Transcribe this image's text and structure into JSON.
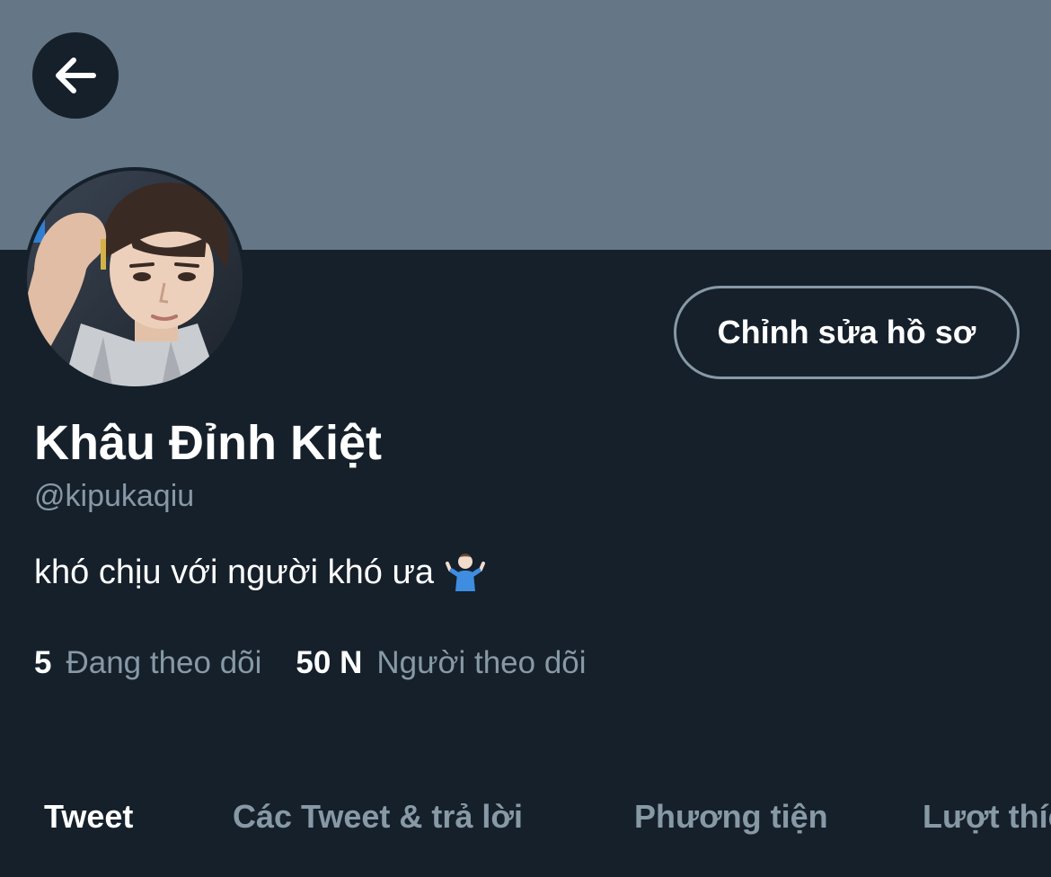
{
  "header": {
    "back_icon": "arrow-left-icon",
    "banner_color": "#657786"
  },
  "profile": {
    "avatar_icon": "profile-photo",
    "edit_button_label": "Chỉnh sửa hồ sơ",
    "display_name": "Khâu Đỉnh Kiệt",
    "handle": "@kipukaqiu",
    "bio": "khó chịu với người khó ưa",
    "bio_emoji": "person-shrugging-icon"
  },
  "stats": {
    "following_count": "5",
    "following_label": "Đang theo dõi",
    "followers_count": "50 N",
    "followers_label": "Người theo dõi"
  },
  "tabs": [
    {
      "label": "Tweet",
      "active": true
    },
    {
      "label": "Các Tweet & trả lời",
      "active": false
    },
    {
      "label": "Phương tiện",
      "active": false
    },
    {
      "label": "Lượt thích",
      "active": false
    }
  ],
  "colors": {
    "background": "#15202b",
    "secondary_text": "#8899a6",
    "primary_text": "#ffffff"
  }
}
